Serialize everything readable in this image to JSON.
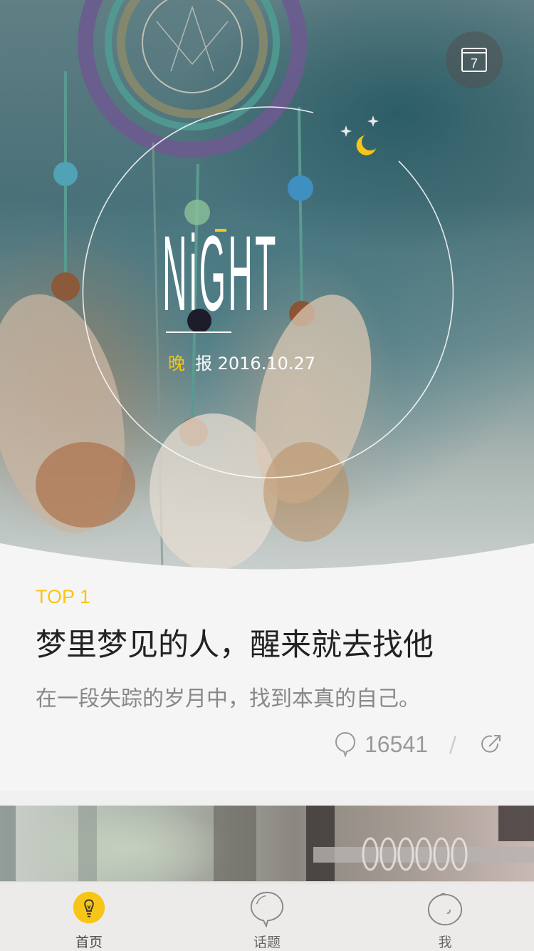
{
  "hero": {
    "title": "NiGHT",
    "edition_accent": "晚",
    "edition_rest": "报 2016.10.27",
    "calendar_day": "7"
  },
  "article": {
    "rank": "TOP 1",
    "headline": "梦里梦见的人，醒来就去找他",
    "subline": "在一段失踪的岁月中，找到本真的自己。",
    "comment_count": "16541",
    "separator": "/"
  },
  "tabs": [
    {
      "label": "首页",
      "icon": "lightbulb-icon",
      "active": true
    },
    {
      "label": "话题",
      "icon": "speech-bubble-icon",
      "active": false
    },
    {
      "label": "我",
      "icon": "face-icon",
      "active": false
    }
  ],
  "colors": {
    "accent": "#f7c517",
    "headline": "#222222",
    "subline": "#888888"
  }
}
